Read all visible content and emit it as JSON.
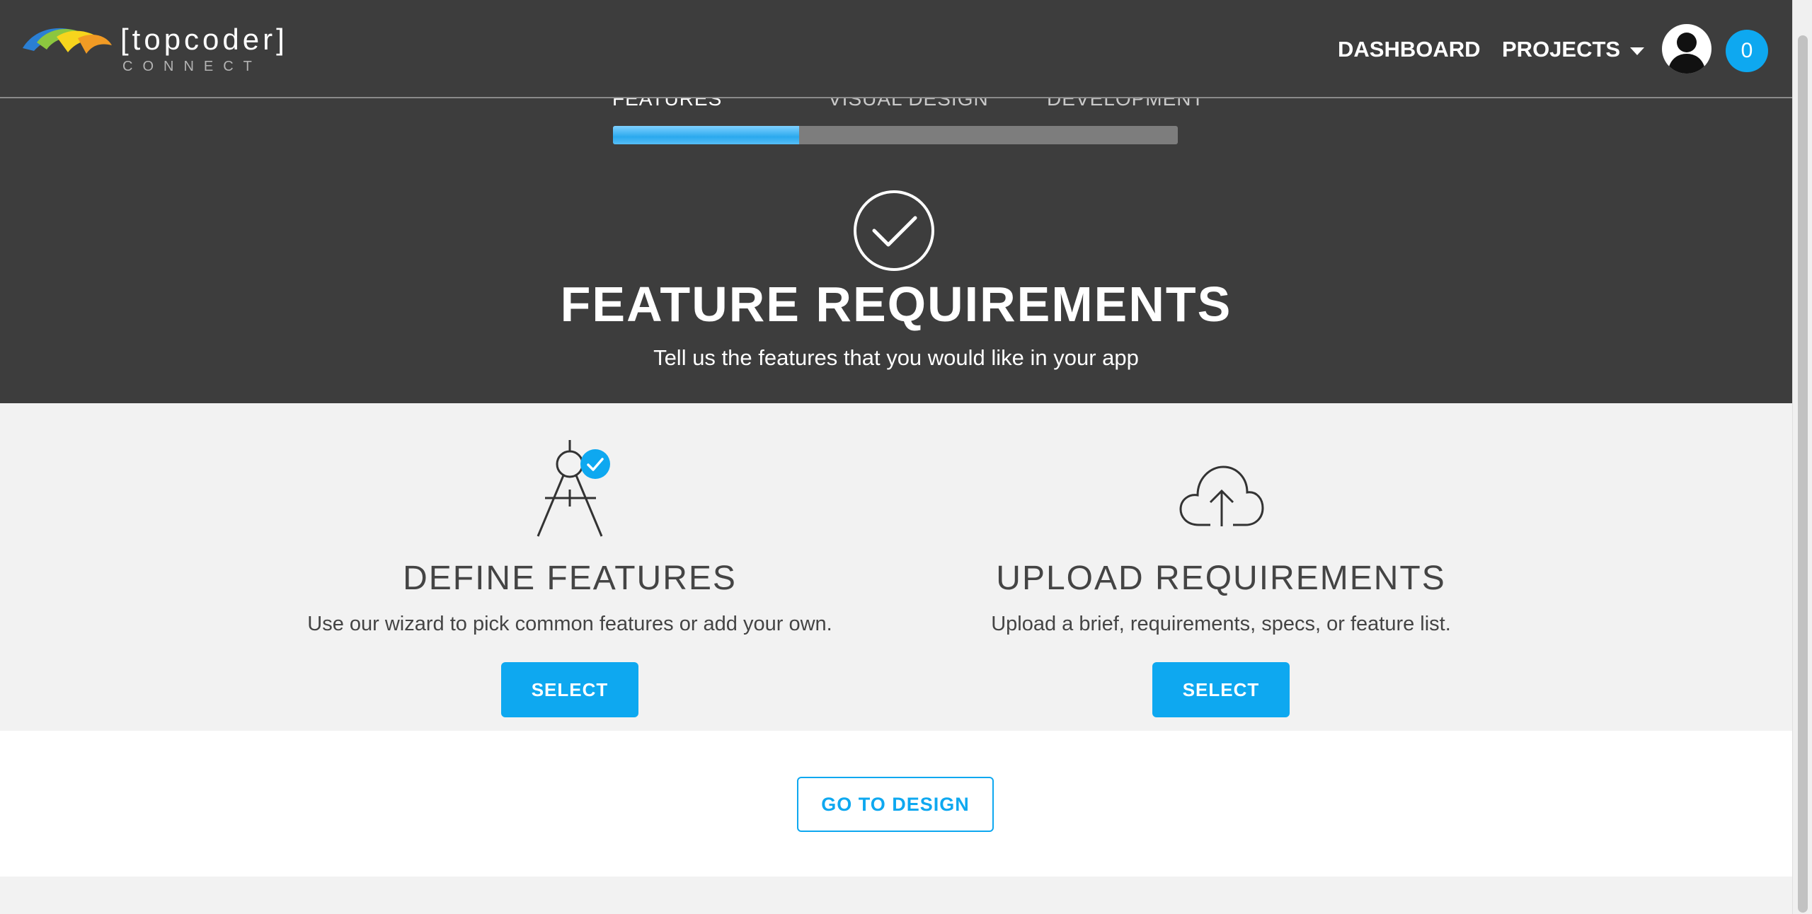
{
  "header": {
    "brand_name": "[topcoder]",
    "brand_sub": "CONNECT",
    "nav": {
      "dashboard": "DASHBOARD",
      "projects": "PROJECTS"
    },
    "notification_count": "0"
  },
  "wizard": {
    "steps": [
      {
        "label": "FEATURES",
        "active": true
      },
      {
        "label": "VISUAL DESIGN",
        "active": false
      },
      {
        "label": "DEVELOPMENT",
        "active": false
      }
    ],
    "progress_fraction": 0.33
  },
  "hero": {
    "icon": "check-circle-icon",
    "title": "FEATURE REQUIREMENTS",
    "subtitle": "Tell us the features that you would like in your app"
  },
  "options": [
    {
      "icon": "compass-icon",
      "title": "DEFINE FEATURES",
      "description": "Use our wizard to pick common features or add your own.",
      "button_label": "SELECT"
    },
    {
      "icon": "cloud-upload-icon",
      "title": "UPLOAD REQUIREMENTS",
      "description": "Upload a brief, requirements, specs, or feature list.",
      "button_label": "SELECT"
    }
  ],
  "footer": {
    "go_button": "GO TO DESIGN"
  },
  "colors": {
    "accent": "#0ea8f0",
    "header_bg": "#3d3d3d",
    "panel_bg": "#f2f2f2",
    "text": "#444444"
  }
}
